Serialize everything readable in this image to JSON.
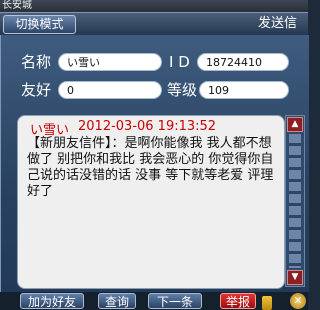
{
  "location": {
    "city": "长安城"
  },
  "header": {
    "mode_button": "切换模式",
    "send_info": "发送信"
  },
  "profile": {
    "name_label": "名称",
    "name_value": "い雪い",
    "id_label": "I D",
    "id_value": "18724410",
    "friendship_label": "友好",
    "friendship_value": "0",
    "level_label": "等级",
    "level_value": "109"
  },
  "message": {
    "sender": "い雪い",
    "time": "2012-03-06 19:13:52",
    "text": "【新朋友信件】：是啊你能像我  我人都不想做了     别把你和我比     我会恶心的      你觉得你自己说的话没错的话    没事   等下就等老爱  评理好了"
  },
  "toolbar": {
    "add_friend": "加为好友",
    "query": "查询",
    "next": "下一条",
    "report": "举报"
  },
  "icons": {
    "scroll_up": "up-arrow-icon",
    "scroll_down": "down-arrow-icon",
    "close": "close-icon"
  }
}
